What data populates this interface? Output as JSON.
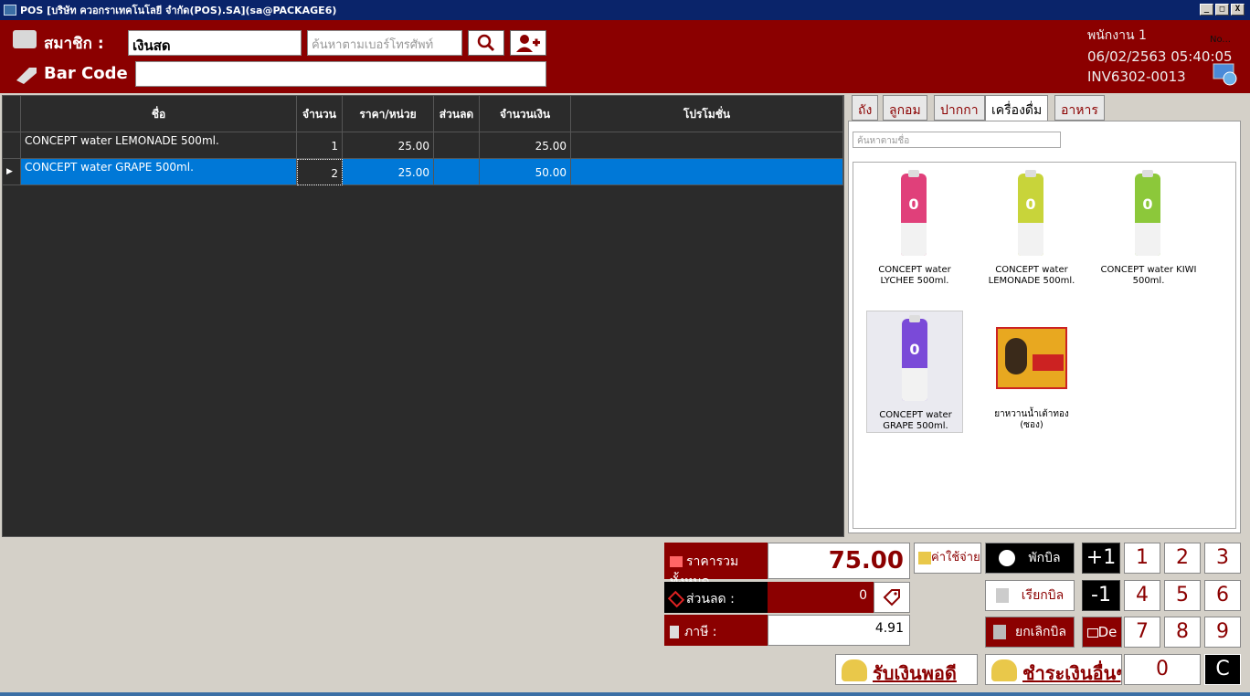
{
  "window": {
    "title": "POS [บริษัท ควอกราเทคโนโลยี จำกัด(POS).SA](sa@PACKAGE6)",
    "min": "_",
    "max": "□",
    "close": "X"
  },
  "header": {
    "member_label": "สมาชิก :",
    "member_value": "เงินสด",
    "phone_placeholder": "ค้นหาตามเบอร์โทรศัพท์",
    "barcode_label": "Bar Code :",
    "barcode_value": "",
    "employee": "พนักงาน 1",
    "datetime": "06/02/2563 05:40:05",
    "invoice": "INV6302-0013",
    "network_label": "No..."
  },
  "grid": {
    "columns": [
      "ชื่อ",
      "จำนวน",
      "ราคา/หน่วย",
      "ส่วนลด",
      "จำนวนเงิน",
      "โปรโมชั่น"
    ],
    "rows": [
      {
        "name": "CONCEPT water LEMONADE 500ml.",
        "qty": "1",
        "price": "25.00",
        "discount": "",
        "amount": "25.00",
        "promo": ""
      },
      {
        "name": "CONCEPT water GRAPE 500ml.",
        "qty": "2",
        "price": "25.00",
        "discount": "",
        "amount": "50.00",
        "promo": ""
      }
    ]
  },
  "tabs": [
    "ถัง",
    "ลูกอม",
    "ปากกา",
    "เครื่องดื่ม",
    "อาหาร"
  ],
  "product_search_placeholder": "ค้นหาตามชื่อ",
  "products": [
    {
      "name": "CONCEPT water LYCHEE 500ml.",
      "color": "#e0407a"
    },
    {
      "name": "CONCEPT water LEMONADE 500ml.",
      "color": "#c8d43a"
    },
    {
      "name": "CONCEPT water KIWI 500ml.",
      "color": "#8cc83a"
    },
    {
      "name": "CONCEPT water GRAPE 500ml.",
      "color": "#7a4ad8"
    },
    {
      "name": "ยาหวานน้ำเต้าทอง (ซอง)",
      "color": "#e8a820"
    }
  ],
  "summary": {
    "total_label": "ราคารวมทั้งหมด",
    "total": "75.00",
    "discount_label": "ส่วนลด :",
    "discount": "0",
    "tax_label": "ภาษี :",
    "tax": "4.91"
  },
  "buttons": {
    "expense": "ค่าใช้จ่าย",
    "hold_bill": "พักบิล",
    "recall_bill": "เรียกบิล",
    "cancel_bill": "ยกเลิกบิล",
    "plus_one": "+1",
    "minus_one": "-1",
    "delete": "De",
    "clear": "C",
    "zero": "0",
    "pay_exact": "รับเงินพอดี",
    "pay_other": "ชำระเงินอื่นๆ"
  },
  "numpad": [
    "1",
    "2",
    "3",
    "4",
    "5",
    "6",
    "7",
    "8",
    "9"
  ],
  "colors": {
    "brand": "#8b0000",
    "selection": "#0078d7",
    "titlebar": "#0a246a"
  }
}
